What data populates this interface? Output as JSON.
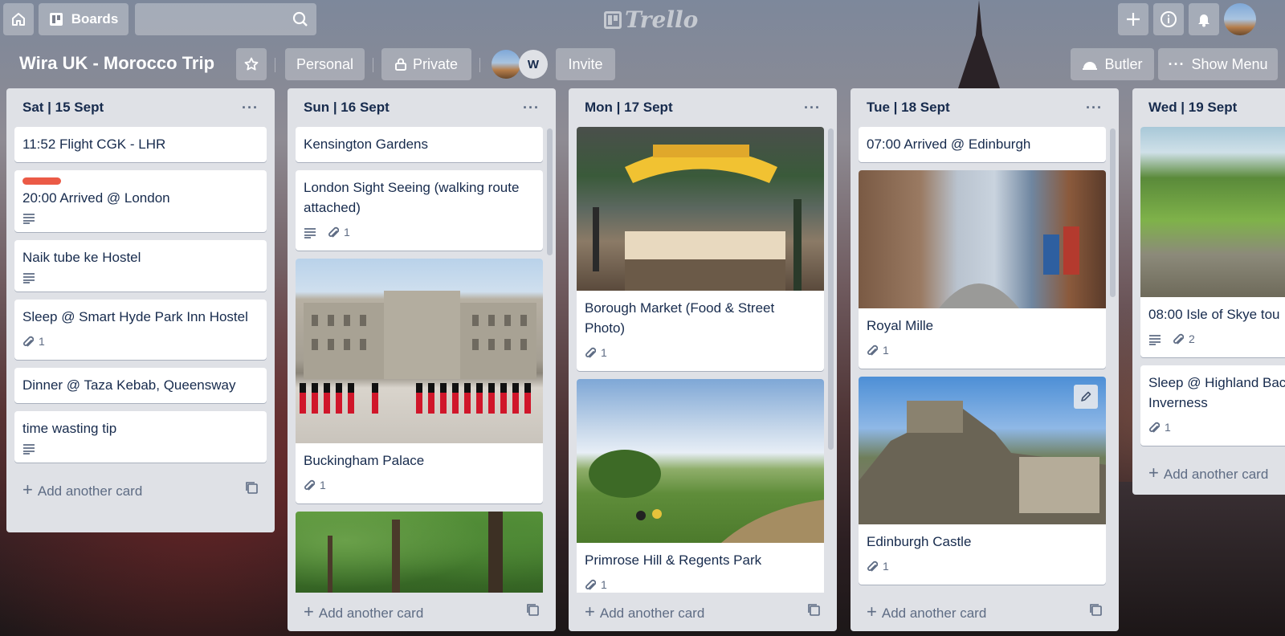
{
  "header": {
    "boards_label": "Boards",
    "logo_text": "Trello"
  },
  "board": {
    "title": "Wira UK - Morocco Trip",
    "team_label": "Personal",
    "visibility_label": "Private",
    "member_initial": "W",
    "invite_label": "Invite",
    "butler_label": "Butler",
    "menu_label": "Show Menu"
  },
  "lists": [
    {
      "title": "Sat | 15 Sept",
      "add_label": "Add another card",
      "cards": [
        {
          "title": "11:52 Flight CGK - LHR"
        },
        {
          "title": "20:00 Arrived @ London",
          "label": "red",
          "description": true
        },
        {
          "title": "Naik tube ke Hostel",
          "description": true
        },
        {
          "title": "Sleep @ Smart Hyde Park Inn Hostel",
          "attachments": "1"
        },
        {
          "title": "Dinner @ Taza Kebab, Queensway"
        },
        {
          "title": "time wasting tip",
          "description": true
        }
      ]
    },
    {
      "title": "Sun | 16 Sept",
      "add_label": "Add another card",
      "cards": [
        {
          "title": "Kensington Gardens"
        },
        {
          "title": "London Sight Seeing (walking route attached)",
          "description": true,
          "attachments": "1"
        },
        {
          "title": "Buckingham Palace",
          "cover": "palace",
          "attachments": "1"
        },
        {
          "title": "",
          "cover": "trees"
        }
      ]
    },
    {
      "title": "Mon | 17 Sept",
      "add_label": "Add another card",
      "cards": [
        {
          "title": "Borough Market (Food & Street Photo)",
          "cover": "market",
          "attachments": "1"
        },
        {
          "title": "Primrose Hill & Regents Park",
          "cover": "park",
          "attachments": "1"
        }
      ]
    },
    {
      "title": "Tue | 18 Sept",
      "add_label": "Add another card",
      "cards": [
        {
          "title": "07:00 Arrived @ Edinburgh"
        },
        {
          "title": "Royal Mille",
          "cover": "street",
          "attachments": "1"
        },
        {
          "title": "Edinburgh Castle",
          "cover": "castle",
          "attachments": "1"
        }
      ]
    },
    {
      "title": "Wed | 19 Sept",
      "add_label": "Add another card",
      "cards": [
        {
          "title": "08:00 Isle of Skye tou",
          "cover": "cliffs",
          "description": true,
          "attachments": "2"
        },
        {
          "title": "Sleep @ Highland Bac Inverness",
          "attachments": "1"
        }
      ]
    }
  ],
  "colors": {
    "list_bg": "#dfe1e6",
    "label_red": "#eb5a46",
    "text": "#172b4d",
    "muted": "#5e6c84"
  }
}
